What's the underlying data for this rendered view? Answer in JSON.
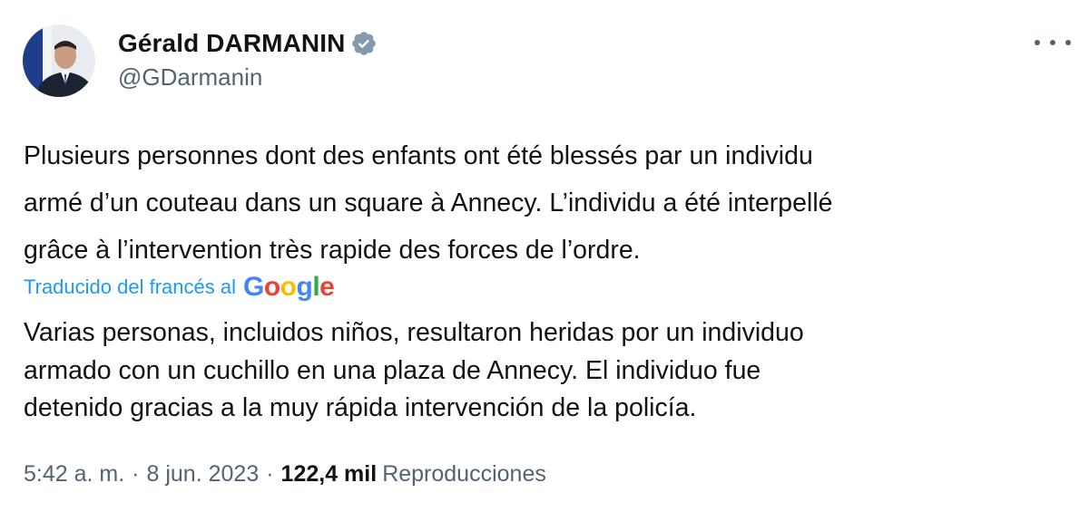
{
  "author": {
    "display_name": "Gérald DARMANIN",
    "handle": "@GDarmanin",
    "verified": true,
    "avatar_icon": "profile-photo"
  },
  "tweet": {
    "lines": [
      "Plusieurs personnes dont des enfants ont été blessés par un individu",
      "armé d’un couteau dans un square à Annecy. L’individu a été interpellé",
      "grâce à l’intervention très rapide des forces de l’ordre."
    ]
  },
  "translation": {
    "label": "Traducido del francés al",
    "provider_letters": [
      "G",
      "o",
      "o",
      "g",
      "l",
      "e"
    ],
    "lines": [
      "Varias personas, incluidos niños, resultaron heridas por un individuo",
      "armado con un cuchillo en una plaza de Annecy. El individuo fue",
      "detenido gracias a la muy rápida intervención de la policía."
    ]
  },
  "meta": {
    "time": "5:42 a. m.",
    "separator": "·",
    "date": "8 jun. 2023",
    "views_count": "122,4 mil",
    "views_label": "Reproducciones"
  },
  "icons": {
    "verified": "verified-badge-icon",
    "more": "more-options-icon"
  },
  "colors": {
    "link": "#1d9bf0",
    "secondary_text": "#536471",
    "primary_text": "#0f1419",
    "google_blue": "#4285f4",
    "google_red": "#ea4335",
    "google_yellow": "#fbbc05",
    "google_green": "#34a853"
  }
}
